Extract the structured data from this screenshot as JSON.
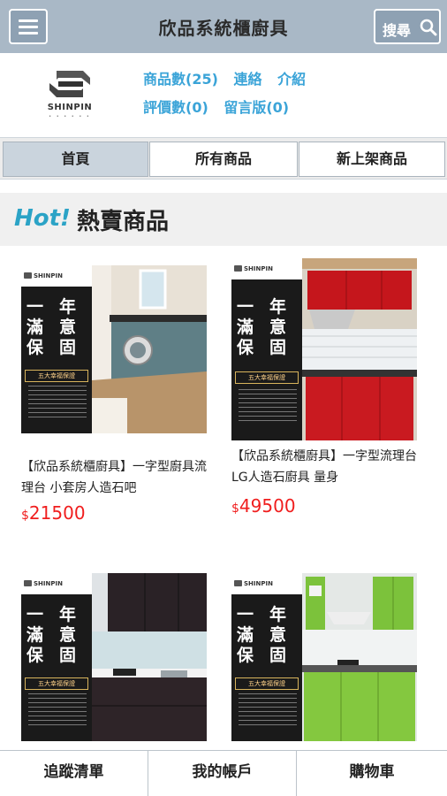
{
  "header": {
    "title": "欣品系統櫃廚具",
    "search_label": "搜尋",
    "menu_icon": "hamburger-icon",
    "search_icon": "magnifier-icon"
  },
  "store": {
    "logo_text": "SHINPIN",
    "links": {
      "products": "商品數(25)",
      "contact": "連絡",
      "intro": "介紹",
      "reviews": "評價數(0)",
      "guestbook": "留言版(0)"
    }
  },
  "tabs": [
    {
      "label": "首頁",
      "active": true
    },
    {
      "label": "所有商品",
      "active": false
    },
    {
      "label": "新上架商品",
      "active": false
    }
  ],
  "section": {
    "hot": "Hot!",
    "title": "熱賣商品"
  },
  "banner": {
    "brand": "SHINPIN",
    "headline": "一年滿意保固",
    "ribbon": "五大幸福保證"
  },
  "products": [
    {
      "name": "【欣品系統櫃廚具】一字型廚具流理台 小套房人造石吧",
      "currency": "$",
      "price": "21500"
    },
    {
      "name": "【欣品系統櫃廚具】一字型流理台 LG人造石廚具 量身",
      "currency": "$",
      "price": "49500"
    },
    {
      "name": "",
      "currency": "",
      "price": ""
    },
    {
      "name": "",
      "currency": "",
      "price": ""
    }
  ],
  "bottom_nav": [
    {
      "label": "追蹤清單"
    },
    {
      "label": "我的帳戶"
    },
    {
      "label": "購物車"
    }
  ],
  "colors": {
    "header_bg": "#a9b8c6",
    "link": "#3ba4d8",
    "hot": "#2ba3c6",
    "price": "#f01e1e"
  }
}
